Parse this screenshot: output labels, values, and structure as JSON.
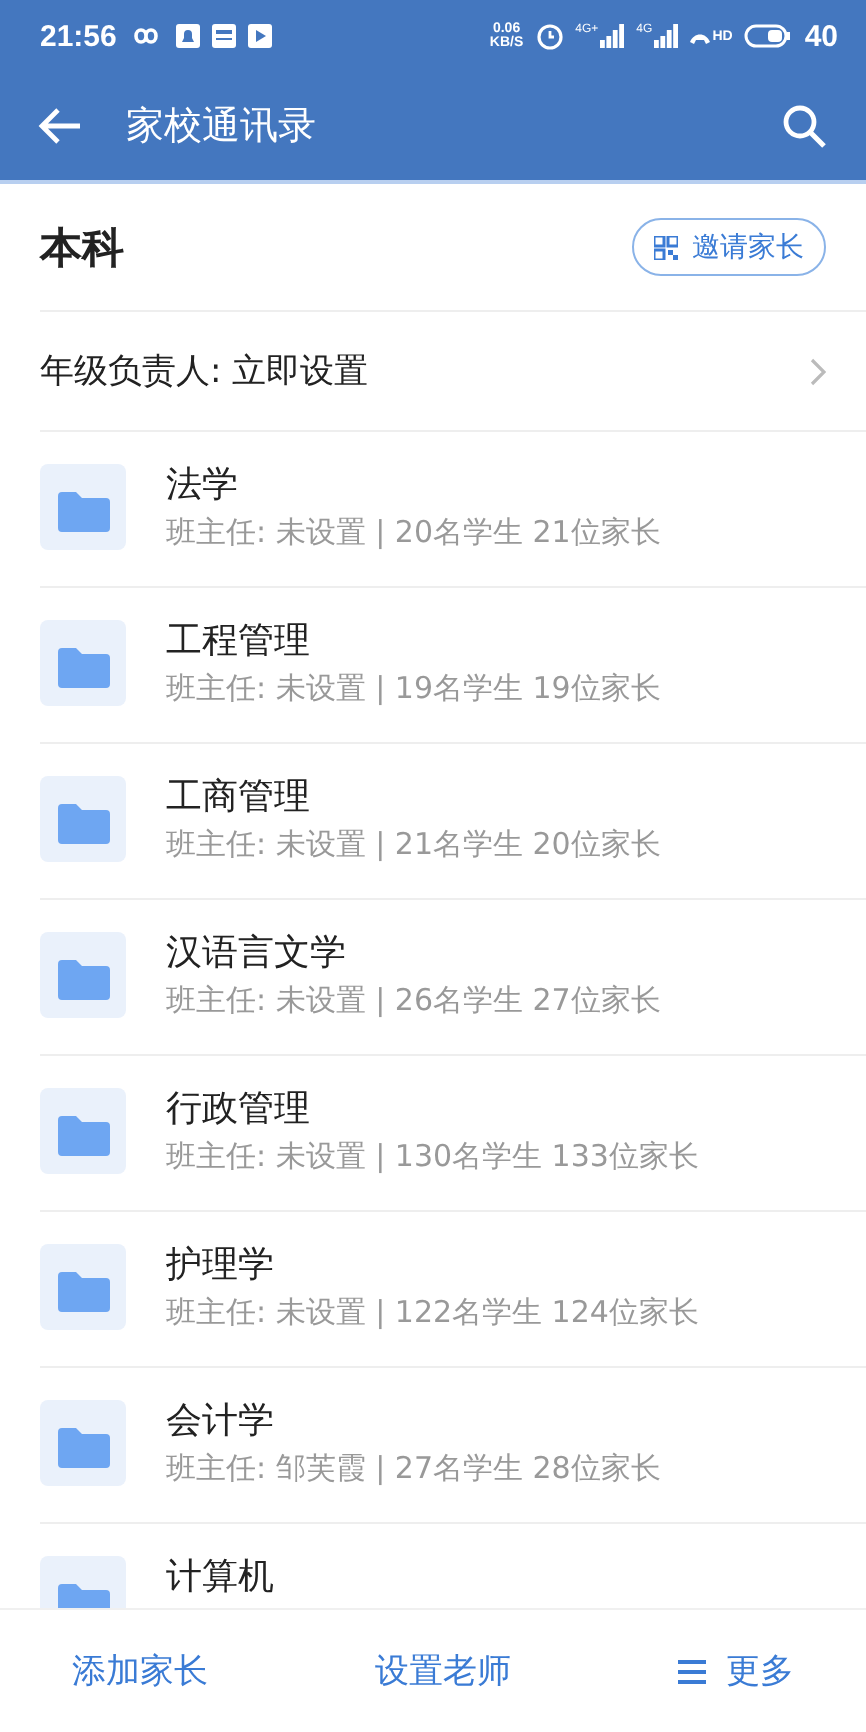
{
  "status_bar": {
    "time": "21:56",
    "net_speed": "0.06",
    "net_unit": "KB/S",
    "signal_1": "4G+",
    "signal_2": "4G",
    "hd": "HD",
    "battery": "40"
  },
  "app_bar": {
    "title": "家校通讯录"
  },
  "section": {
    "title": "本科",
    "invite_button": "邀请家长"
  },
  "grade_row": {
    "label": "年级负责人: 立即设置"
  },
  "classes": [
    {
      "name": "法学",
      "detail": "班主任: 未设置 | 20名学生 21位家长"
    },
    {
      "name": "工程管理",
      "detail": "班主任: 未设置 | 19名学生 19位家长"
    },
    {
      "name": "工商管理",
      "detail": "班主任: 未设置 | 21名学生 20位家长"
    },
    {
      "name": "汉语言文学",
      "detail": "班主任: 未设置 | 26名学生 27位家长"
    },
    {
      "name": "行政管理",
      "detail": "班主任: 未设置 | 130名学生 133位家长"
    },
    {
      "name": "护理学",
      "detail": "班主任: 未设置 | 122名学生 124位家长"
    },
    {
      "name": "会计学",
      "detail": "班主任: 邹芙霞 | 27名学生 28位家长"
    },
    {
      "name": "计算机"
    }
  ],
  "bottom_bar": [
    {
      "kind": "text",
      "label": "添加家长"
    },
    {
      "kind": "text",
      "label": "设置老师"
    },
    {
      "kind": "menu",
      "label": "更多"
    }
  ]
}
